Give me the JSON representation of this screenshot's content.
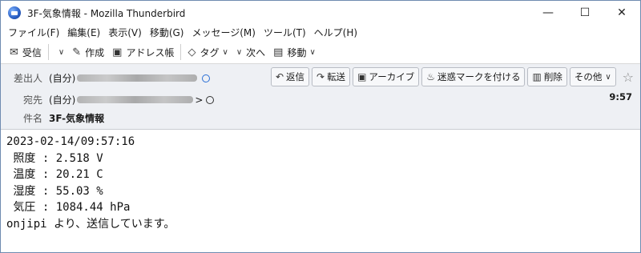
{
  "window": {
    "title": "3F-気象情報 - Mozilla Thunderbird",
    "minimize": "—",
    "maximize": "☐",
    "close": "✕"
  },
  "menu": [
    "ファイル(F)",
    "編集(E)",
    "表示(V)",
    "移動(G)",
    "メッセージ(M)",
    "ツール(T)",
    "ヘルプ(H)"
  ],
  "toolbar": {
    "receive": "受信",
    "compose": "作成",
    "addressbook": "アドレス帳",
    "tag": "タグ",
    "next": "次へ",
    "move": "移動"
  },
  "header": {
    "from_label": "差出人",
    "from_value": "(自分)",
    "to_label": "宛先",
    "to_value": "(自分)",
    "to_suffix": ">",
    "subject_label": "件名",
    "subject_value": "3F-気象情報",
    "time": "9:57",
    "actions": {
      "reply": "返信",
      "forward": "転送",
      "archive": "アーカイブ",
      "junk": "迷惑マークを付ける",
      "delete": "削除",
      "other": "その他"
    }
  },
  "body": {
    "lines": [
      "2023-02-14/09:57:16",
      " 照度 : 2.518 V",
      " 温度 : 20.21 C",
      " 湿度 : 55.03 %",
      " 気圧 : 1084.44 hPa",
      "onjipi より、送信しています。"
    ]
  },
  "icons": {
    "receive": "envelope-icon",
    "compose": "pencil-icon",
    "addressbook": "address-book-icon",
    "tag": "tag-icon",
    "move": "folder-icon"
  }
}
